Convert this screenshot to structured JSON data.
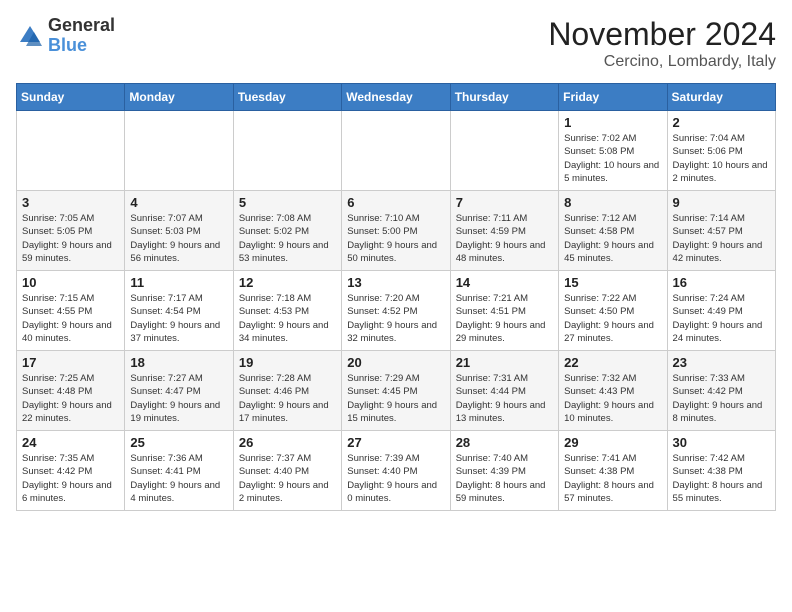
{
  "logo": {
    "text_general": "General",
    "text_blue": "Blue"
  },
  "header": {
    "month_year": "November 2024",
    "location": "Cercino, Lombardy, Italy"
  },
  "days_of_week": [
    "Sunday",
    "Monday",
    "Tuesday",
    "Wednesday",
    "Thursday",
    "Friday",
    "Saturday"
  ],
  "weeks": [
    [
      {
        "day": "",
        "info": ""
      },
      {
        "day": "",
        "info": ""
      },
      {
        "day": "",
        "info": ""
      },
      {
        "day": "",
        "info": ""
      },
      {
        "day": "",
        "info": ""
      },
      {
        "day": "1",
        "info": "Sunrise: 7:02 AM\nSunset: 5:08 PM\nDaylight: 10 hours and 5 minutes."
      },
      {
        "day": "2",
        "info": "Sunrise: 7:04 AM\nSunset: 5:06 PM\nDaylight: 10 hours and 2 minutes."
      }
    ],
    [
      {
        "day": "3",
        "info": "Sunrise: 7:05 AM\nSunset: 5:05 PM\nDaylight: 9 hours and 59 minutes."
      },
      {
        "day": "4",
        "info": "Sunrise: 7:07 AM\nSunset: 5:03 PM\nDaylight: 9 hours and 56 minutes."
      },
      {
        "day": "5",
        "info": "Sunrise: 7:08 AM\nSunset: 5:02 PM\nDaylight: 9 hours and 53 minutes."
      },
      {
        "day": "6",
        "info": "Sunrise: 7:10 AM\nSunset: 5:00 PM\nDaylight: 9 hours and 50 minutes."
      },
      {
        "day": "7",
        "info": "Sunrise: 7:11 AM\nSunset: 4:59 PM\nDaylight: 9 hours and 48 minutes."
      },
      {
        "day": "8",
        "info": "Sunrise: 7:12 AM\nSunset: 4:58 PM\nDaylight: 9 hours and 45 minutes."
      },
      {
        "day": "9",
        "info": "Sunrise: 7:14 AM\nSunset: 4:57 PM\nDaylight: 9 hours and 42 minutes."
      }
    ],
    [
      {
        "day": "10",
        "info": "Sunrise: 7:15 AM\nSunset: 4:55 PM\nDaylight: 9 hours and 40 minutes."
      },
      {
        "day": "11",
        "info": "Sunrise: 7:17 AM\nSunset: 4:54 PM\nDaylight: 9 hours and 37 minutes."
      },
      {
        "day": "12",
        "info": "Sunrise: 7:18 AM\nSunset: 4:53 PM\nDaylight: 9 hours and 34 minutes."
      },
      {
        "day": "13",
        "info": "Sunrise: 7:20 AM\nSunset: 4:52 PM\nDaylight: 9 hours and 32 minutes."
      },
      {
        "day": "14",
        "info": "Sunrise: 7:21 AM\nSunset: 4:51 PM\nDaylight: 9 hours and 29 minutes."
      },
      {
        "day": "15",
        "info": "Sunrise: 7:22 AM\nSunset: 4:50 PM\nDaylight: 9 hours and 27 minutes."
      },
      {
        "day": "16",
        "info": "Sunrise: 7:24 AM\nSunset: 4:49 PM\nDaylight: 9 hours and 24 minutes."
      }
    ],
    [
      {
        "day": "17",
        "info": "Sunrise: 7:25 AM\nSunset: 4:48 PM\nDaylight: 9 hours and 22 minutes."
      },
      {
        "day": "18",
        "info": "Sunrise: 7:27 AM\nSunset: 4:47 PM\nDaylight: 9 hours and 19 minutes."
      },
      {
        "day": "19",
        "info": "Sunrise: 7:28 AM\nSunset: 4:46 PM\nDaylight: 9 hours and 17 minutes."
      },
      {
        "day": "20",
        "info": "Sunrise: 7:29 AM\nSunset: 4:45 PM\nDaylight: 9 hours and 15 minutes."
      },
      {
        "day": "21",
        "info": "Sunrise: 7:31 AM\nSunset: 4:44 PM\nDaylight: 9 hours and 13 minutes."
      },
      {
        "day": "22",
        "info": "Sunrise: 7:32 AM\nSunset: 4:43 PM\nDaylight: 9 hours and 10 minutes."
      },
      {
        "day": "23",
        "info": "Sunrise: 7:33 AM\nSunset: 4:42 PM\nDaylight: 9 hours and 8 minutes."
      }
    ],
    [
      {
        "day": "24",
        "info": "Sunrise: 7:35 AM\nSunset: 4:42 PM\nDaylight: 9 hours and 6 minutes."
      },
      {
        "day": "25",
        "info": "Sunrise: 7:36 AM\nSunset: 4:41 PM\nDaylight: 9 hours and 4 minutes."
      },
      {
        "day": "26",
        "info": "Sunrise: 7:37 AM\nSunset: 4:40 PM\nDaylight: 9 hours and 2 minutes."
      },
      {
        "day": "27",
        "info": "Sunrise: 7:39 AM\nSunset: 4:40 PM\nDaylight: 9 hours and 0 minutes."
      },
      {
        "day": "28",
        "info": "Sunrise: 7:40 AM\nSunset: 4:39 PM\nDaylight: 8 hours and 59 minutes."
      },
      {
        "day": "29",
        "info": "Sunrise: 7:41 AM\nSunset: 4:38 PM\nDaylight: 8 hours and 57 minutes."
      },
      {
        "day": "30",
        "info": "Sunrise: 7:42 AM\nSunset: 4:38 PM\nDaylight: 8 hours and 55 minutes."
      }
    ]
  ]
}
